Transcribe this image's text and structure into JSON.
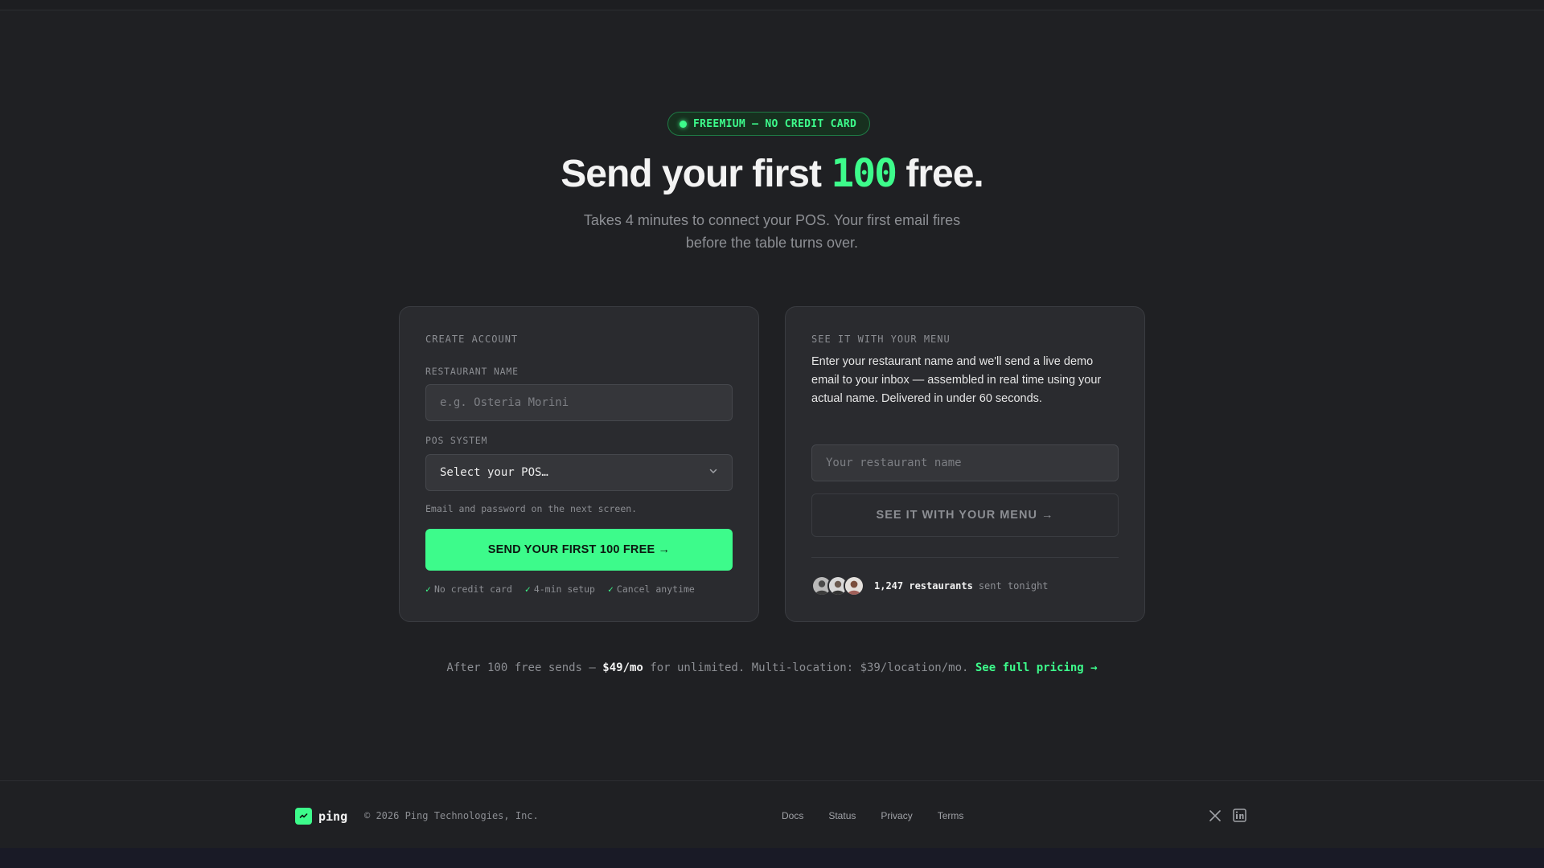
{
  "hero": {
    "badge": "FREEMIUM — NO CREDIT CARD",
    "headline_pre": "Send your first ",
    "headline_accent": "100",
    "headline_post": " free.",
    "subhead": "Takes 4 minutes to connect your POS. Your first email fires before the table turns over."
  },
  "create_account": {
    "eyebrow": "CREATE ACCOUNT",
    "restaurant_label": "RESTAURANT NAME",
    "restaurant_placeholder": "e.g. Osteria Morini",
    "pos_label": "POS SYSTEM",
    "pos_selected": "Select your POS…",
    "hint": "Email and password on the next screen.",
    "cta": "SEND YOUR FIRST 100 FREE →",
    "checks": [
      "No credit card",
      "4-min setup",
      "Cancel anytime"
    ]
  },
  "demo": {
    "eyebrow": "SEE IT WITH YOUR MENU",
    "description": "Enter your restaurant name and we'll send a live demo email to your inbox — assembled in real time using your actual name. Delivered in under 60 seconds.",
    "input_placeholder": "Your restaurant name",
    "button": "SEE IT WITH YOUR MENU →",
    "social_count": "1,247 restaurants",
    "social_suffix": "sent tonight"
  },
  "pricing": {
    "pre": "After 100 free sends — ",
    "price": "$49/mo",
    "mid": " for unlimited. Multi-location: $39/location/mo. ",
    "link": "See full pricing →"
  },
  "footer": {
    "brand": "ping",
    "copyright": "© 2026 Ping Technologies, Inc.",
    "links": [
      "Docs",
      "Status",
      "Privacy",
      "Terms"
    ],
    "social_icons": [
      "x-icon",
      "linkedin-icon"
    ]
  },
  "colors": {
    "background": "#1f2023",
    "card": "#2a2b2f",
    "accent": "#3dfb8b",
    "muted_text": "#8c8e93"
  }
}
